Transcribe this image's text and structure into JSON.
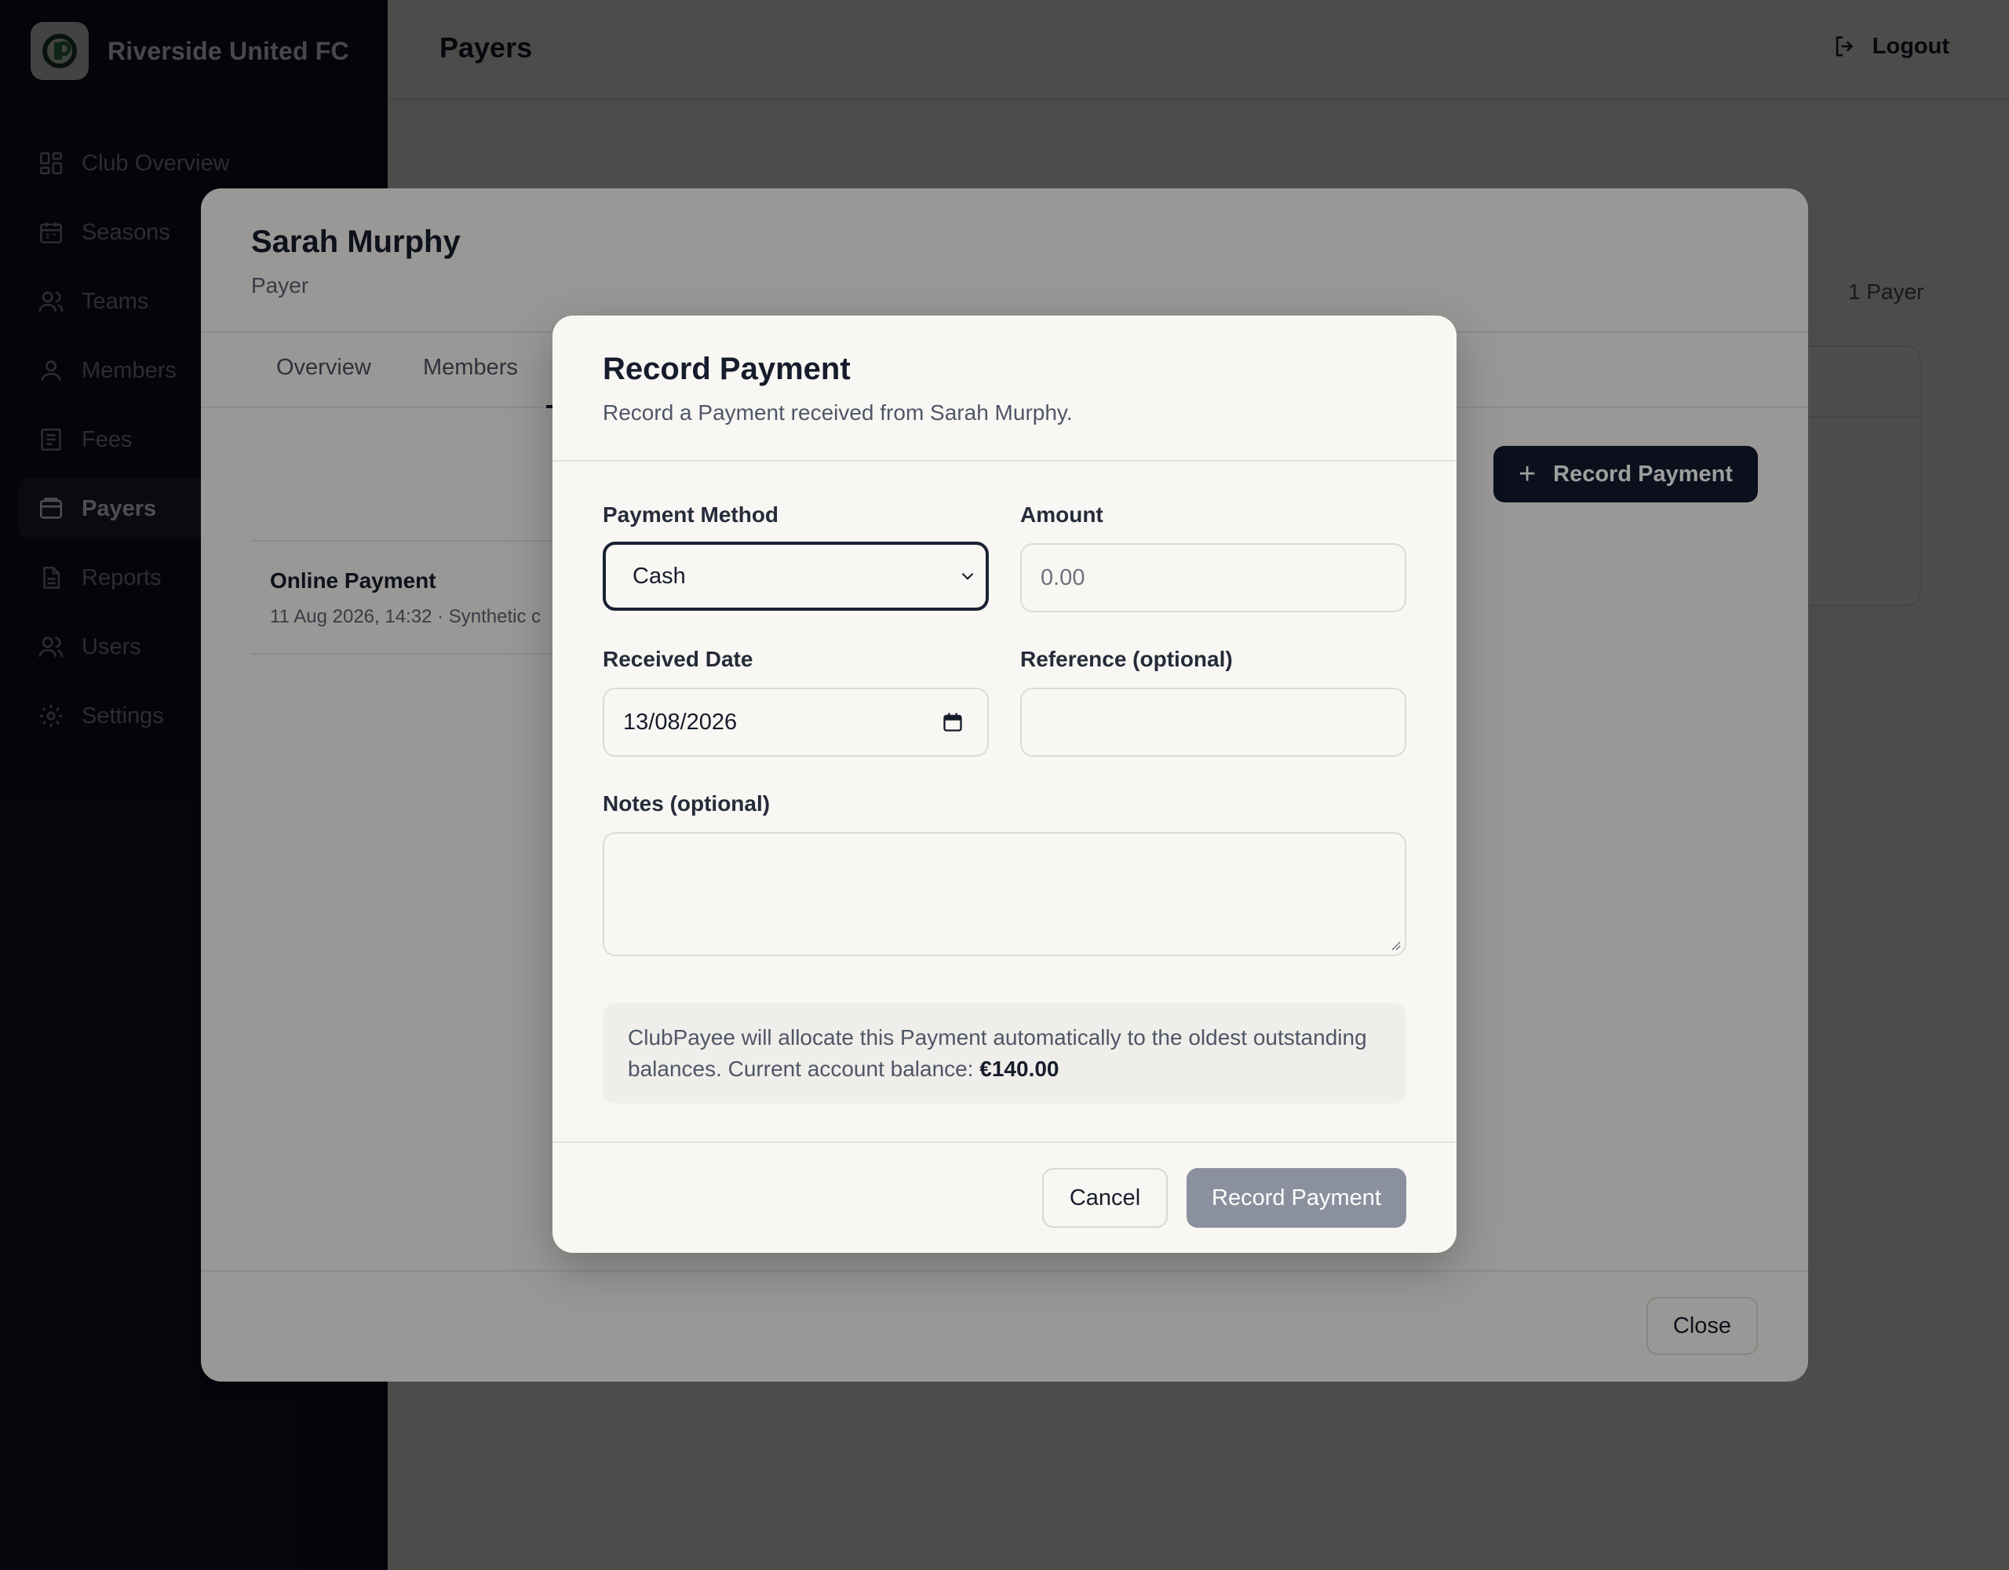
{
  "brand": {
    "name": "Riverside United FC",
    "logo_icon": "clubpayee-logo-icon"
  },
  "sidebar": {
    "items": [
      {
        "label": "Club Overview",
        "icon": "dashboard-icon"
      },
      {
        "label": "Seasons",
        "icon": "calendar-icon"
      },
      {
        "label": "Teams",
        "icon": "users-icon"
      },
      {
        "label": "Members",
        "icon": "user-icon"
      },
      {
        "label": "Fees",
        "icon": "receipt-icon"
      },
      {
        "label": "Payers",
        "icon": "wallet-icon",
        "active": true
      },
      {
        "label": "Reports",
        "icon": "document-icon"
      },
      {
        "label": "Users",
        "icon": "users-icon"
      },
      {
        "label": "Settings",
        "icon": "gear-icon"
      }
    ]
  },
  "header": {
    "title": "Payers",
    "logout_label": "Logout"
  },
  "background": {
    "payer_count": "1 Payer"
  },
  "payer_modal": {
    "name": "Sarah Murphy",
    "role": "Payer",
    "tabs": [
      "Overview",
      "Members"
    ],
    "record_payment_label": "Record Payment",
    "transaction": {
      "title": "Online Payment",
      "subtitle": "11 Aug 2026, 14:32 · Synthetic c"
    },
    "close_label": "Close"
  },
  "dialog": {
    "title": "Record Payment",
    "subtitle": "Record a Payment received from Sarah Murphy.",
    "payment_method": {
      "label": "Payment Method",
      "value": "Cash"
    },
    "amount": {
      "label": "Amount",
      "placeholder": "0.00"
    },
    "received_date": {
      "label": "Received Date",
      "value": "13/08/2026"
    },
    "reference": {
      "label": "Reference (optional)",
      "value": ""
    },
    "notes": {
      "label": "Notes (optional)",
      "value": ""
    },
    "info_text": "ClubPayee will allocate this Payment automatically to the oldest outstanding balances. Current account balance:",
    "balance": "€140.00",
    "cancel_label": "Cancel",
    "submit_label": "Record Payment"
  },
  "colors": {
    "sidebar_bg": "#0d1324",
    "primary": "#141b2f",
    "disabled_button": "#8b909e",
    "surface": "#f8f7f3"
  }
}
